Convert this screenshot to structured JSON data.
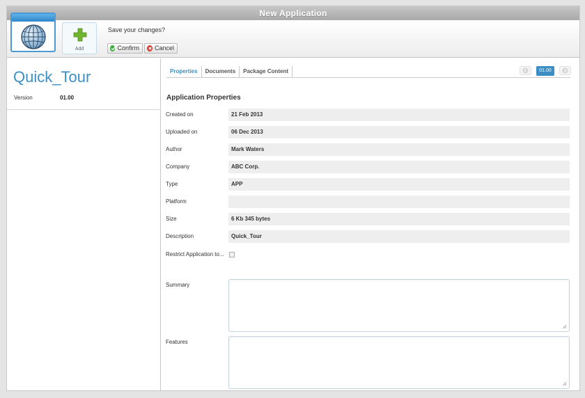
{
  "window": {
    "title": "New Application"
  },
  "toolbar": {
    "app_icon": "globe-icon",
    "add_icon": "plus-icon",
    "add_label": "Add",
    "prompt": "Save your changes?",
    "confirm_label": "Confirm",
    "cancel_label": "Cancel"
  },
  "left": {
    "app_name": "Quick_Tour",
    "version_label": "Version",
    "version_value": "01.00"
  },
  "tabs": [
    {
      "label": "Properties",
      "active": true
    },
    {
      "label": "Documents",
      "active": false
    },
    {
      "label": "Package Content",
      "active": false
    }
  ],
  "pager": {
    "current": "01.00",
    "prev_icon": "arrow-left-icon",
    "next_icon": "arrow-right-icon"
  },
  "section_title": "Application Properties",
  "properties": [
    {
      "label": "Created on",
      "value": "21 Feb 2013"
    },
    {
      "label": "Uploaded on",
      "value": "06 Dec 2013"
    },
    {
      "label": "Author",
      "value": "Mark Waters"
    },
    {
      "label": "Company",
      "value": "ABC Corp."
    },
    {
      "label": "Type",
      "value": "APP"
    },
    {
      "label": "Platform",
      "value": ""
    },
    {
      "label": "Size",
      "value": "6 Kb 345 bytes"
    },
    {
      "label": "Description",
      "value": "Quick_Tour"
    }
  ],
  "restrict_label": "Restrict Application to...",
  "summary_label": "Summary",
  "summary_value": "",
  "features_label": "Features",
  "features_value": "",
  "colors": {
    "accent": "#3b8fc4",
    "confirm": "#3cae3c",
    "cancel": "#d9382f"
  }
}
